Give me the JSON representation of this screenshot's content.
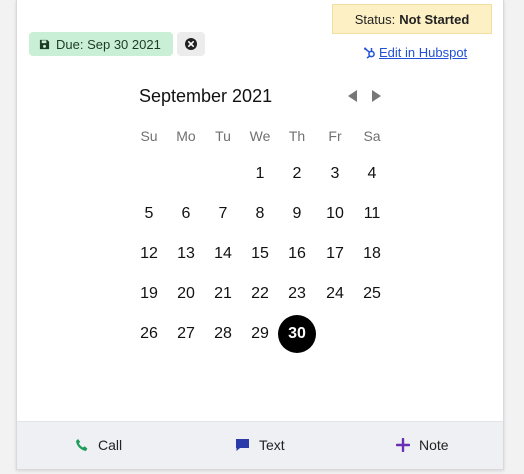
{
  "due_chip": {
    "label": "Due: Sep 30 2021",
    "color": "#c9f0d6"
  },
  "status": {
    "prefix": "Status:",
    "value": "Not Started",
    "color": "#fdf0c4"
  },
  "hubspot_link": {
    "label": "Edit in Hubspot",
    "color": "#2151d6"
  },
  "calendar": {
    "month_title": "September 2021",
    "weekdays": [
      "Su",
      "Mo",
      "Tu",
      "We",
      "Th",
      "Fr",
      "Sa"
    ],
    "weeks": [
      [
        "",
        "",
        "",
        "1",
        "2",
        "3",
        "4"
      ],
      [
        "5",
        "6",
        "7",
        "8",
        "9",
        "10",
        "11"
      ],
      [
        "12",
        "13",
        "14",
        "15",
        "16",
        "17",
        "18"
      ],
      [
        "19",
        "20",
        "21",
        "22",
        "23",
        "24",
        "25"
      ],
      [
        "26",
        "27",
        "28",
        "29",
        "30",
        "",
        ""
      ]
    ],
    "selected_day": "30"
  },
  "actions": [
    {
      "label": "Call",
      "icon": "phone-icon",
      "color": "#1f9e5b"
    },
    {
      "label": "Text",
      "icon": "chat-bubble-icon",
      "color": "#2a3aa8"
    },
    {
      "label": "Note",
      "icon": "plus-icon",
      "color": "#6a2fb4"
    }
  ]
}
